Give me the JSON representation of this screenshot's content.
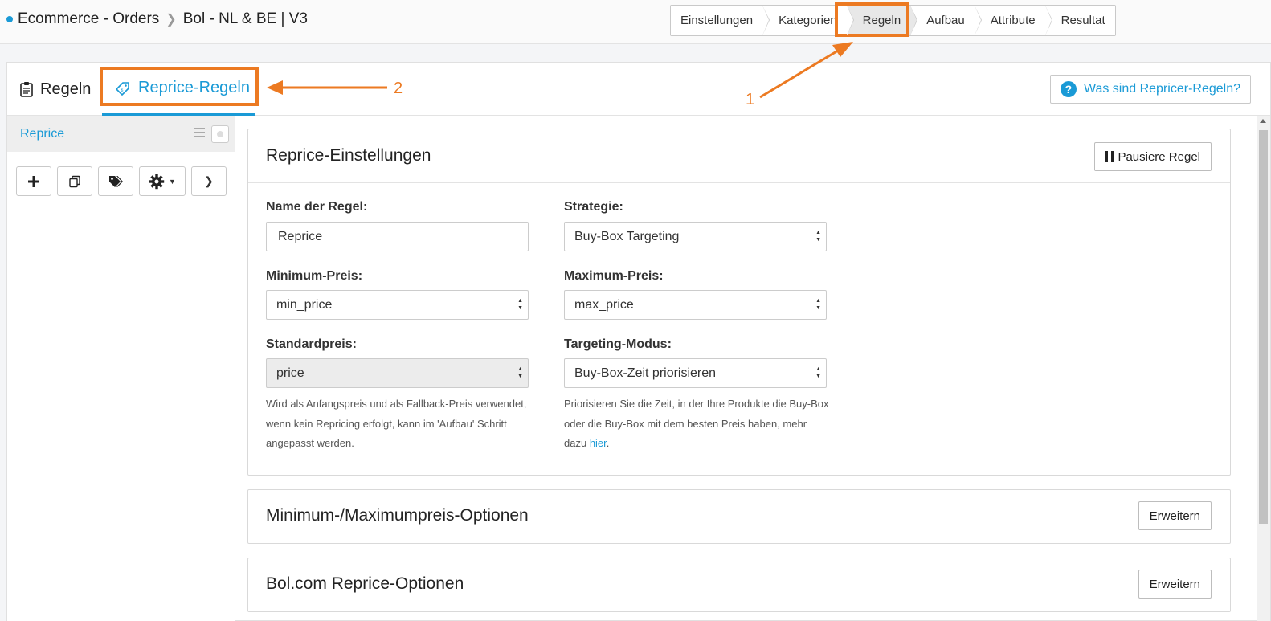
{
  "breadcrumb": {
    "items": [
      "Ecommerce - Orders",
      "Bol - NL & BE | V3"
    ]
  },
  "wizard": {
    "steps": [
      "Einstellungen",
      "Kategorien",
      "Regeln",
      "Aufbau",
      "Attribute",
      "Resultat"
    ],
    "active": "Regeln"
  },
  "tabs": {
    "rules": "Regeln",
    "reprice": "Reprice-Regeln"
  },
  "help_button": "Was sind Repricer-Regeln?",
  "sidebar": {
    "selected_rule": "Reprice"
  },
  "settings_card": {
    "title": "Reprice-Einstellungen",
    "pause_button": "Pausiere Regel",
    "name_label": "Name der Regel:",
    "name_value": "Reprice",
    "strategy_label": "Strategie:",
    "strategy_value": "Buy-Box Targeting",
    "min_label": "Minimum-Preis:",
    "min_value": "min_price",
    "max_label": "Maximum-Preis:",
    "max_value": "max_price",
    "standard_label": "Standardpreis:",
    "standard_value": "price",
    "standard_hint": "Wird als Anfangspreis und als Fallback-Preis verwendet, wenn kein Repricing erfolgt, kann im 'Aufbau' Schritt angepasst werden.",
    "mode_label": "Targeting-Modus:",
    "mode_value": "Buy-Box-Zeit priorisieren",
    "mode_hint": "Priorisieren Sie die Zeit, in der Ihre Produkte die Buy-Box oder die Buy-Box mit dem besten Preis haben, mehr dazu ",
    "mode_hint_link": "hier",
    "mode_hint_end": "."
  },
  "minmax_card": {
    "title": "Minimum-/Maximumpreis-Optionen",
    "expand_button": "Erweitern"
  },
  "bol_card": {
    "title": "Bol.com Reprice-Optionen",
    "expand_button": "Erweitern"
  },
  "annotations": {
    "label_1": "1",
    "label_2": "2",
    "color": "#ec7a22"
  },
  "colors": {
    "accent": "#1a9ad6"
  }
}
